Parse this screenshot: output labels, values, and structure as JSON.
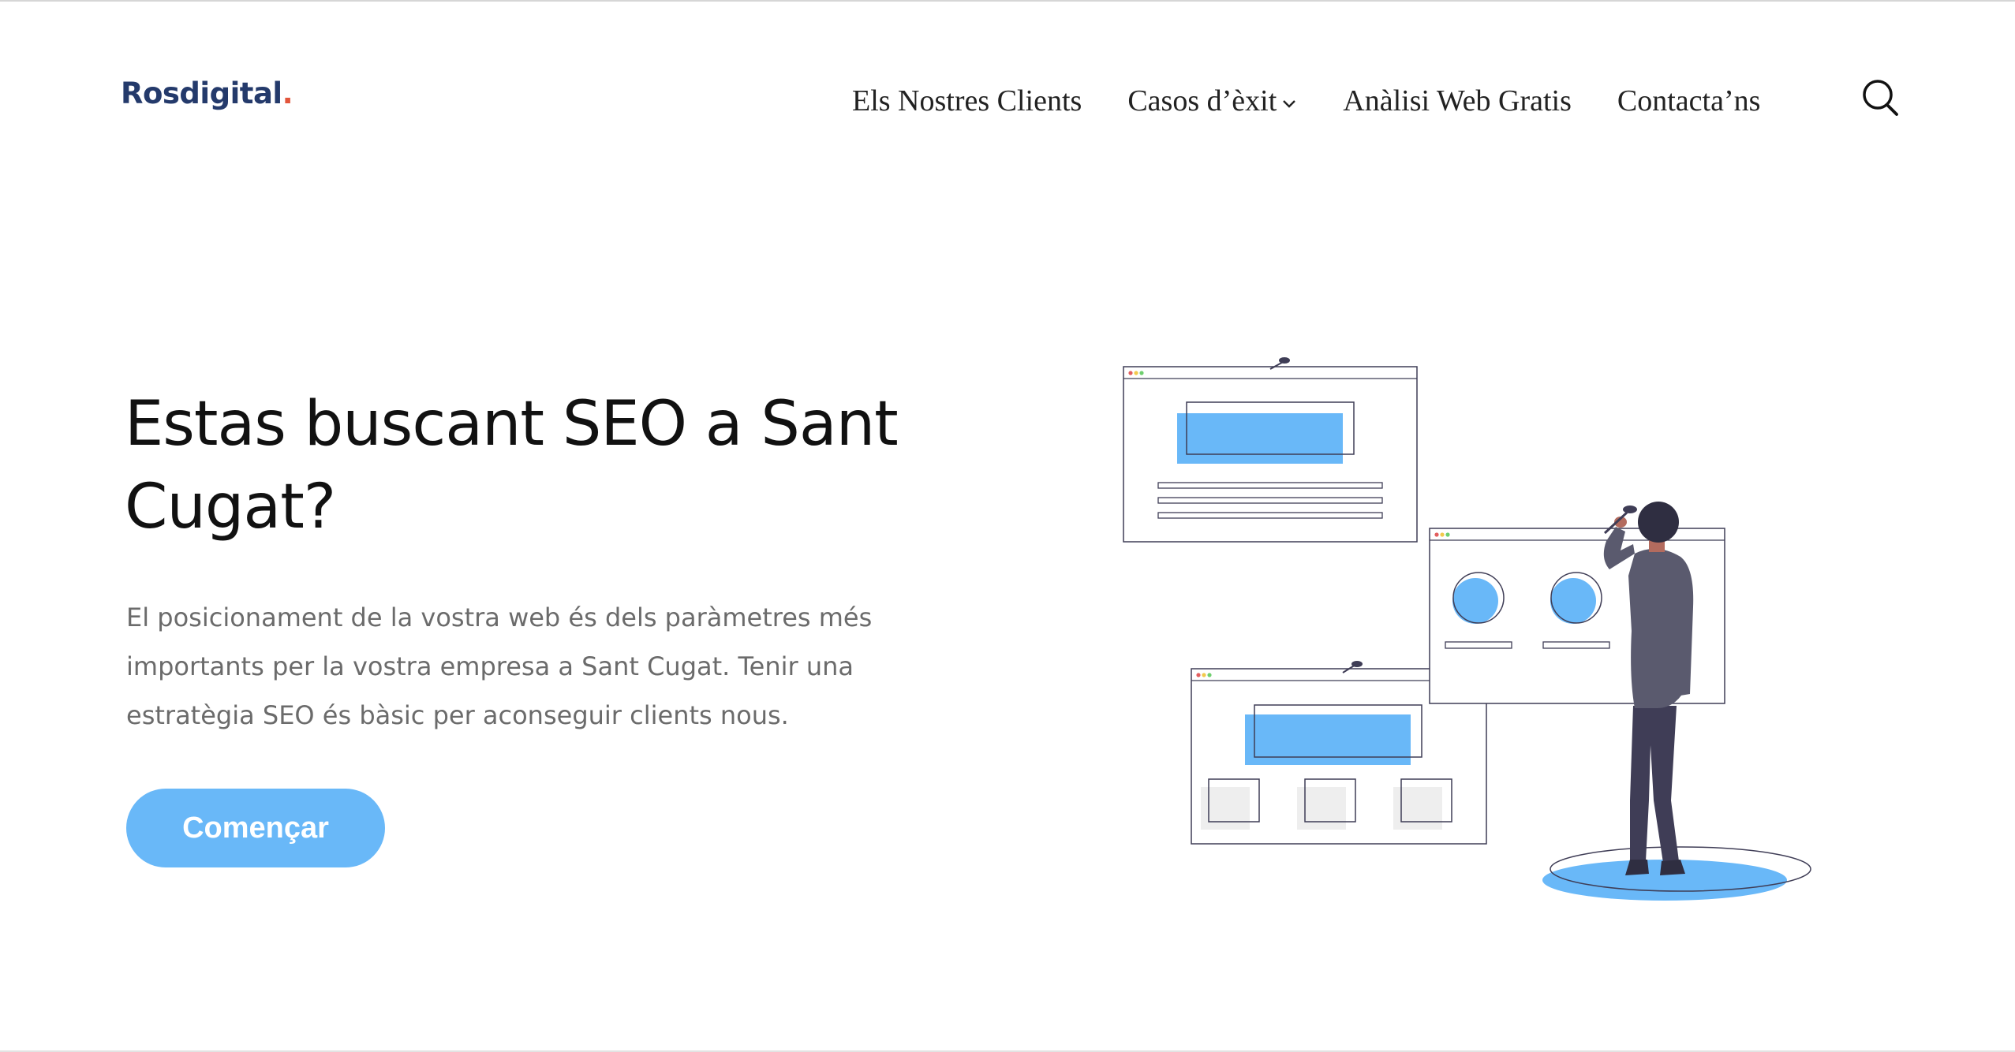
{
  "brand": {
    "name": "Rosdigital",
    "dot": ".",
    "dot_color": "#e2553b",
    "name_color": "#243a6b"
  },
  "nav": {
    "items": [
      {
        "label": "Els Nostres Clients"
      },
      {
        "label": "Casos d’èxit"
      },
      {
        "label": "Anàlisi Web Gratis"
      },
      {
        "label": "Contacta’ns"
      }
    ],
    "search_icon": "search-icon"
  },
  "hero": {
    "title": "Estas buscant SEO a Sant Cugat?",
    "description": "El posicionament de la vostra web és dels paràmetres més importants per la vostra empresa a Sant Cugat. Tenir una estratègia SEO és bàsic per aconseguir clients nous.",
    "cta_label": "Començar"
  },
  "colors": {
    "accent": "#69b8f8",
    "text_dark": "#111111",
    "text_muted": "#6b6b6b",
    "figure_shirt": "#5a5a6e",
    "figure_pants": "#3f3d56"
  }
}
